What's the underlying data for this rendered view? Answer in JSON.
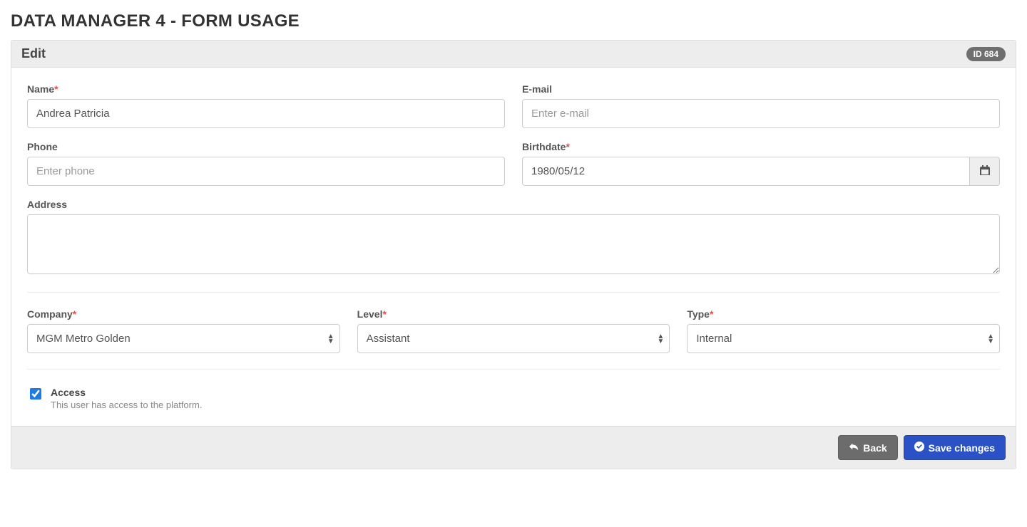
{
  "page": {
    "title": "DATA MANAGER 4 - FORM USAGE"
  },
  "panel": {
    "title": "Edit",
    "id_badge": "ID 684"
  },
  "form": {
    "name": {
      "label": "Name",
      "required": true,
      "value": "Andrea Patricia"
    },
    "email": {
      "label": "E-mail",
      "required": false,
      "value": "",
      "placeholder": "Enter e-mail"
    },
    "phone": {
      "label": "Phone",
      "required": false,
      "value": "",
      "placeholder": "Enter phone"
    },
    "birthdate": {
      "label": "Birthdate",
      "required": true,
      "value": "1980/05/12"
    },
    "address": {
      "label": "Address",
      "required": false,
      "value": ""
    },
    "company": {
      "label": "Company",
      "required": true,
      "value": "MGM Metro Golden"
    },
    "level": {
      "label": "Level",
      "required": true,
      "value": "Assistant"
    },
    "type": {
      "label": "Type",
      "required": true,
      "value": "Internal"
    },
    "access": {
      "label": "Access",
      "checked": true,
      "description": "This user has access to the platform."
    }
  },
  "footer": {
    "back": "Back",
    "save": "Save changes"
  },
  "required_mark": "*"
}
